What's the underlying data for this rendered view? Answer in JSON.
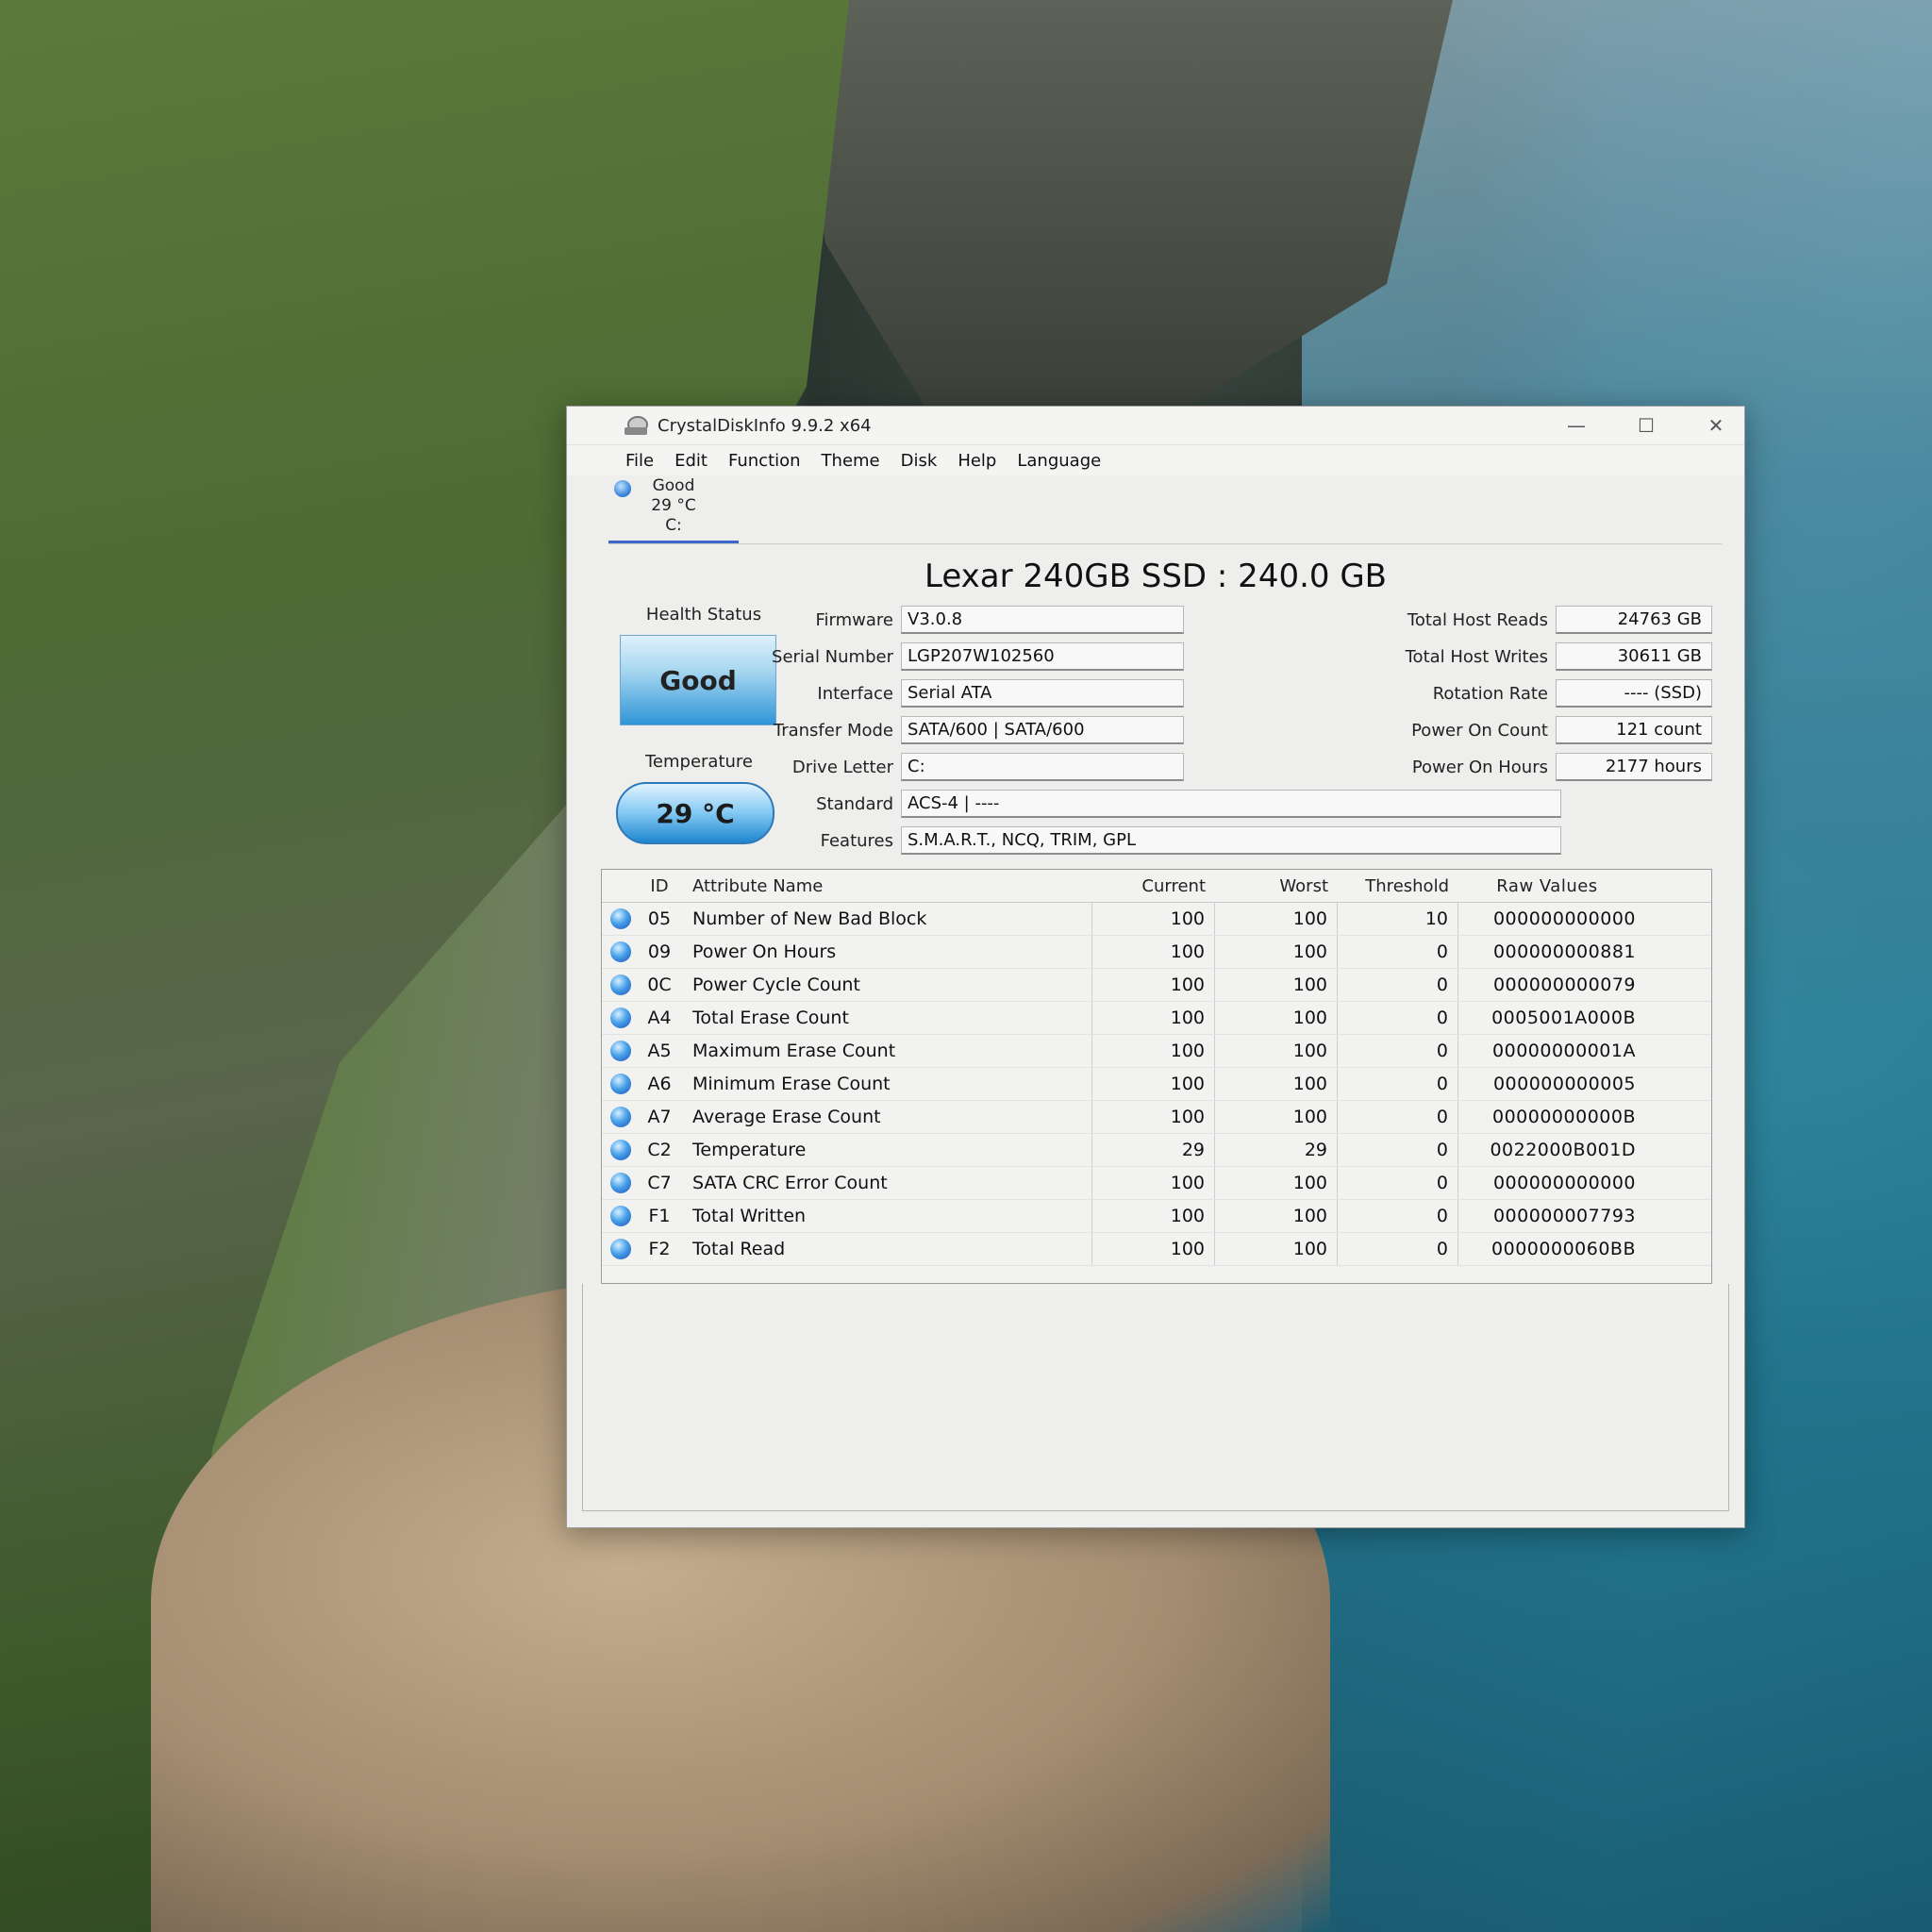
{
  "window": {
    "title": "CrystalDiskInfo 9.9.2 x64",
    "controls": {
      "minimize": "—",
      "maximize": "☐",
      "close": "✕"
    }
  },
  "menu": [
    "File",
    "Edit",
    "Function",
    "Theme",
    "Disk",
    "Help",
    "Language"
  ],
  "disk_tab": {
    "status": "Good",
    "temp": "29 °C",
    "letter": "C:"
  },
  "drive": {
    "title": "Lexar 240GB SSD : 240.0 GB",
    "health_label": "Health Status",
    "health_value": "Good",
    "temp_label": "Temperature",
    "temp_value": "29 °C",
    "firmware_label": "Firmware",
    "firmware": "V3.0.8",
    "serial_label": "Serial Number",
    "serial": "LGP207W102560",
    "interface_label": "Interface",
    "interface": "Serial ATA",
    "transfer_label": "Transfer Mode",
    "transfer": "SATA/600 | SATA/600",
    "letter_label": "Drive Letter",
    "letter": "C:",
    "standard_label": "Standard",
    "standard": "ACS-4 | ----",
    "features_label": "Features",
    "features": "S.M.A.R.T., NCQ, TRIM, GPL",
    "reads_label": "Total Host Reads",
    "reads": "24763 GB",
    "writes_label": "Total Host Writes",
    "writes": "30611 GB",
    "rotation_label": "Rotation Rate",
    "rotation": "---- (SSD)",
    "poc_label": "Power On Count",
    "poc": "121 count",
    "poh_label": "Power On Hours",
    "poh": "2177 hours"
  },
  "smart": {
    "headers": {
      "id": "ID",
      "name": "Attribute Name",
      "current": "Current",
      "worst": "Worst",
      "threshold": "Threshold",
      "raw": "Raw Values"
    },
    "rows": [
      {
        "id": "05",
        "name": "Number of New Bad Block",
        "current": "100",
        "worst": "100",
        "threshold": "10",
        "raw": "000000000000"
      },
      {
        "id": "09",
        "name": "Power On Hours",
        "current": "100",
        "worst": "100",
        "threshold": "0",
        "raw": "000000000881"
      },
      {
        "id": "0C",
        "name": "Power Cycle Count",
        "current": "100",
        "worst": "100",
        "threshold": "0",
        "raw": "000000000079"
      },
      {
        "id": "A4",
        "name": "Total Erase Count",
        "current": "100",
        "worst": "100",
        "threshold": "0",
        "raw": "0005001A000B"
      },
      {
        "id": "A5",
        "name": "Maximum Erase Count",
        "current": "100",
        "worst": "100",
        "threshold": "0",
        "raw": "00000000001A"
      },
      {
        "id": "A6",
        "name": "Minimum Erase Count",
        "current": "100",
        "worst": "100",
        "threshold": "0",
        "raw": "000000000005"
      },
      {
        "id": "A7",
        "name": "Average Erase Count",
        "current": "100",
        "worst": "100",
        "threshold": "0",
        "raw": "00000000000B"
      },
      {
        "id": "C2",
        "name": "Temperature",
        "current": "29",
        "worst": "29",
        "threshold": "0",
        "raw": "0022000B001D"
      },
      {
        "id": "C7",
        "name": "SATA CRC Error Count",
        "current": "100",
        "worst": "100",
        "threshold": "0",
        "raw": "000000000000"
      },
      {
        "id": "F1",
        "name": "Total Written",
        "current": "100",
        "worst": "100",
        "threshold": "0",
        "raw": "000000007793"
      },
      {
        "id": "F2",
        "name": "Total Read",
        "current": "100",
        "worst": "100",
        "threshold": "0",
        "raw": "0000000060BB"
      }
    ]
  }
}
